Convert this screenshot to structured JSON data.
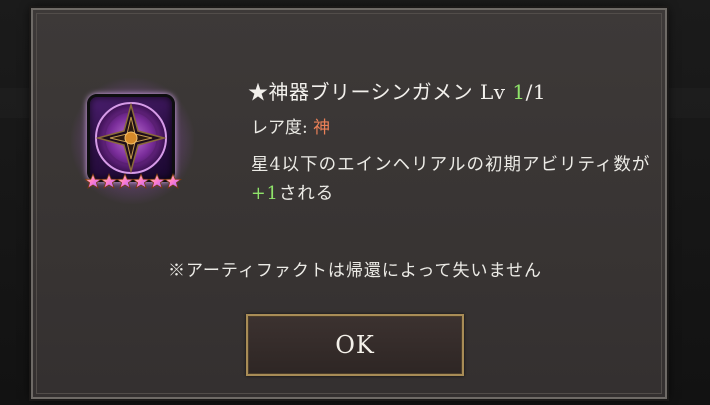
{
  "dialog": {
    "item": {
      "icon": "purple-shield-artifact-icon",
      "star_count": 6,
      "title_prefix": "★神器ブリーシンガメン",
      "level_label": "Lv",
      "level_current": "1",
      "level_sep": "/",
      "level_max": "1",
      "rarity_label": "レア度:",
      "rarity_value": "神"
    },
    "description": {
      "text_before": "星4以下のエインヘリアルの初期アビリティ数が",
      "highlight": "+1",
      "text_after": "される"
    },
    "notice": "※アーティファクトは帰還によって失いません",
    "ok_label": "OK"
  },
  "colors": {
    "accent_green": "#8fe36a",
    "rarity_orange": "#e98058",
    "button_border_gold": "#a88c56"
  }
}
